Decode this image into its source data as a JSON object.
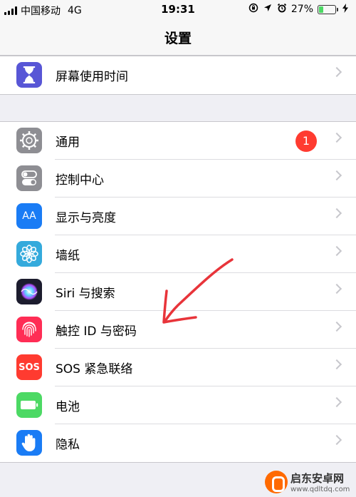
{
  "status_bar": {
    "carrier": "中国移动",
    "network": "4G",
    "time": "19:31",
    "battery": "27%",
    "battery_level": 0.27,
    "icons": [
      "rotation-lock-icon",
      "location-icon",
      "alarm-icon",
      "charging-icon"
    ]
  },
  "nav": {
    "title": "设置"
  },
  "group1": [
    {
      "id": "screen-time",
      "label": "屏幕使用时间",
      "icon": "hourglass-icon",
      "color": "#5856d6"
    }
  ],
  "group2": [
    {
      "id": "general",
      "label": "通用",
      "icon": "gear-icon",
      "color": "#8e8e93",
      "badge": "1"
    },
    {
      "id": "control-center",
      "label": "控制中心",
      "icon": "toggle-icon",
      "color": "#8e8e93"
    },
    {
      "id": "display",
      "label": "显示与亮度",
      "icon": "text-size-icon",
      "color": "#1a7cf5",
      "icon_text": "AA"
    },
    {
      "id": "wallpaper",
      "label": "墙纸",
      "icon": "flower-icon",
      "color": "#34aadc"
    },
    {
      "id": "siri",
      "label": "Siri 与搜索",
      "icon": "siri-icon",
      "color": "#1c1c2e"
    },
    {
      "id": "touch-id",
      "label": "触控 ID 与密码",
      "icon": "fingerprint-icon",
      "color": "#ff2d55"
    },
    {
      "id": "sos",
      "label": "SOS 紧急联络",
      "icon": "sos-icon",
      "color": "#ff3b30",
      "icon_text": "SOS"
    },
    {
      "id": "battery",
      "label": "电池",
      "icon": "battery-icon",
      "color": "#4cd964"
    },
    {
      "id": "privacy",
      "label": "隐私",
      "icon": "hand-icon",
      "color": "#1a7cf5"
    }
  ],
  "watermark": {
    "name": "启东安卓网",
    "url": "www.qdltdq.com"
  },
  "colors": {
    "accent": "#007aff",
    "badge": "#ff3b30",
    "annotation": "#e8343a"
  }
}
